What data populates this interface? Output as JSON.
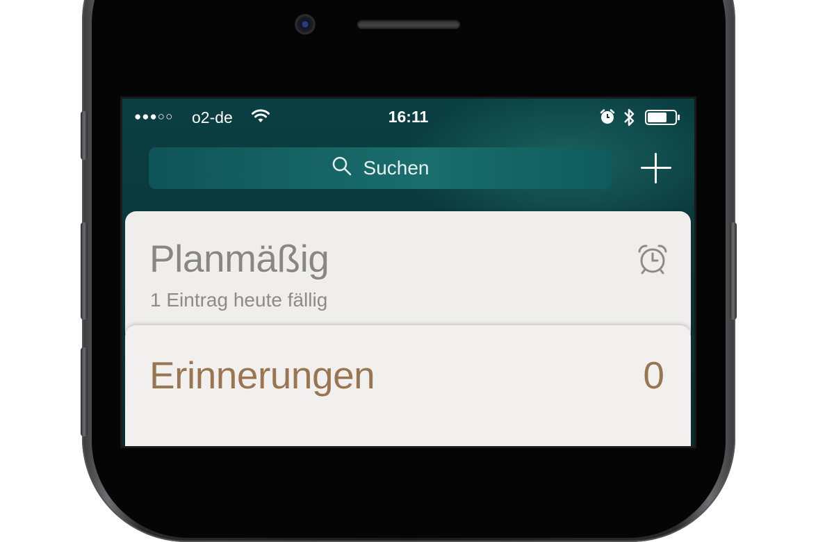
{
  "status_bar": {
    "signal": "●●●○○",
    "carrier": "o2-de",
    "time": "16:11",
    "icons": [
      "wifi-icon",
      "alarm-icon",
      "bluetooth-icon",
      "battery-icon"
    ],
    "battery_level": 0.6
  },
  "search": {
    "placeholder": "Suchen",
    "icon": "search-icon"
  },
  "add_button": {
    "icon": "plus-icon"
  },
  "lists": [
    {
      "title": "Planmäßig",
      "subtitle": "1 Eintrag heute fällig",
      "icon": "alarm-clock-icon",
      "color": "#888785"
    },
    {
      "title": "Erinnerungen",
      "count": "0",
      "color": "#9a7551"
    }
  ],
  "colors": {
    "screen_background": "#0b3438",
    "search_background": "#1a6e6d",
    "card_background": "#efeeec"
  }
}
